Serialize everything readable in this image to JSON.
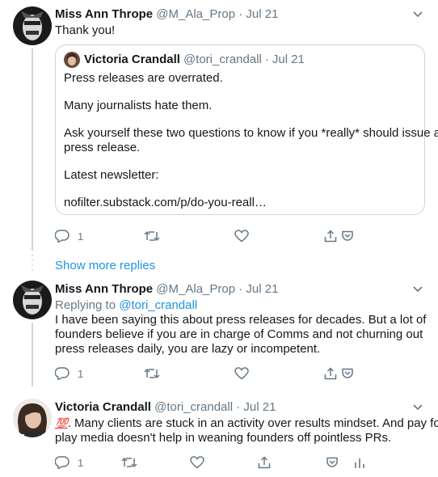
{
  "tweets": [
    {
      "name": "Miss Ann Thrope",
      "handle": "@M_Ala_Prop",
      "dot": "·",
      "date": "Jul 21",
      "text": "Thank you!",
      "quote": {
        "name": "Victoria Crandall",
        "handle": "@tori_crandall",
        "dot": "·",
        "date": "Jul 21",
        "lines": [
          "Press releases are overrated.",
          "Many journalists hate them.",
          "Ask yourself these two questions to know if you *really* should issue a",
          "press release.",
          "Latest newsletter:",
          "nofilter.substack.com/p/do-you-reall…"
        ]
      },
      "reply_count": "1"
    },
    {
      "name": "Miss Ann Thrope",
      "handle": "@M_Ala_Prop",
      "dot": "·",
      "date": "Jul 21",
      "replying_to_label": "Replying to",
      "replying_to_handle": "@tori_crandall",
      "lines": [
        "I have been saying this about press releases for decades. But a lot of",
        "founders believe if you are in charge of Comms and not churning out",
        "press releases daily, you are lazy or incompetent."
      ],
      "reply_count": "1"
    },
    {
      "name": "Victoria Crandall",
      "handle": "@tori_crandall",
      "dot": "·",
      "date": "Jul 21",
      "emoji": "💯",
      "lines": [
        ". Many clients are stuck in an activity over results mindset. And pay for",
        "play media doesn't help in weaning founders off pointless PRs."
      ],
      "reply_count": "1"
    }
  ],
  "show_more_replies": "Show more replies",
  "colors": {
    "link": "#1b95e0",
    "muted": "#657786",
    "border": "#ccd6dd",
    "text": "#14171a"
  },
  "icons": [
    "chevron-down-icon",
    "reply-icon",
    "retweet-icon",
    "like-icon",
    "share-icon",
    "pocket-icon"
  ]
}
